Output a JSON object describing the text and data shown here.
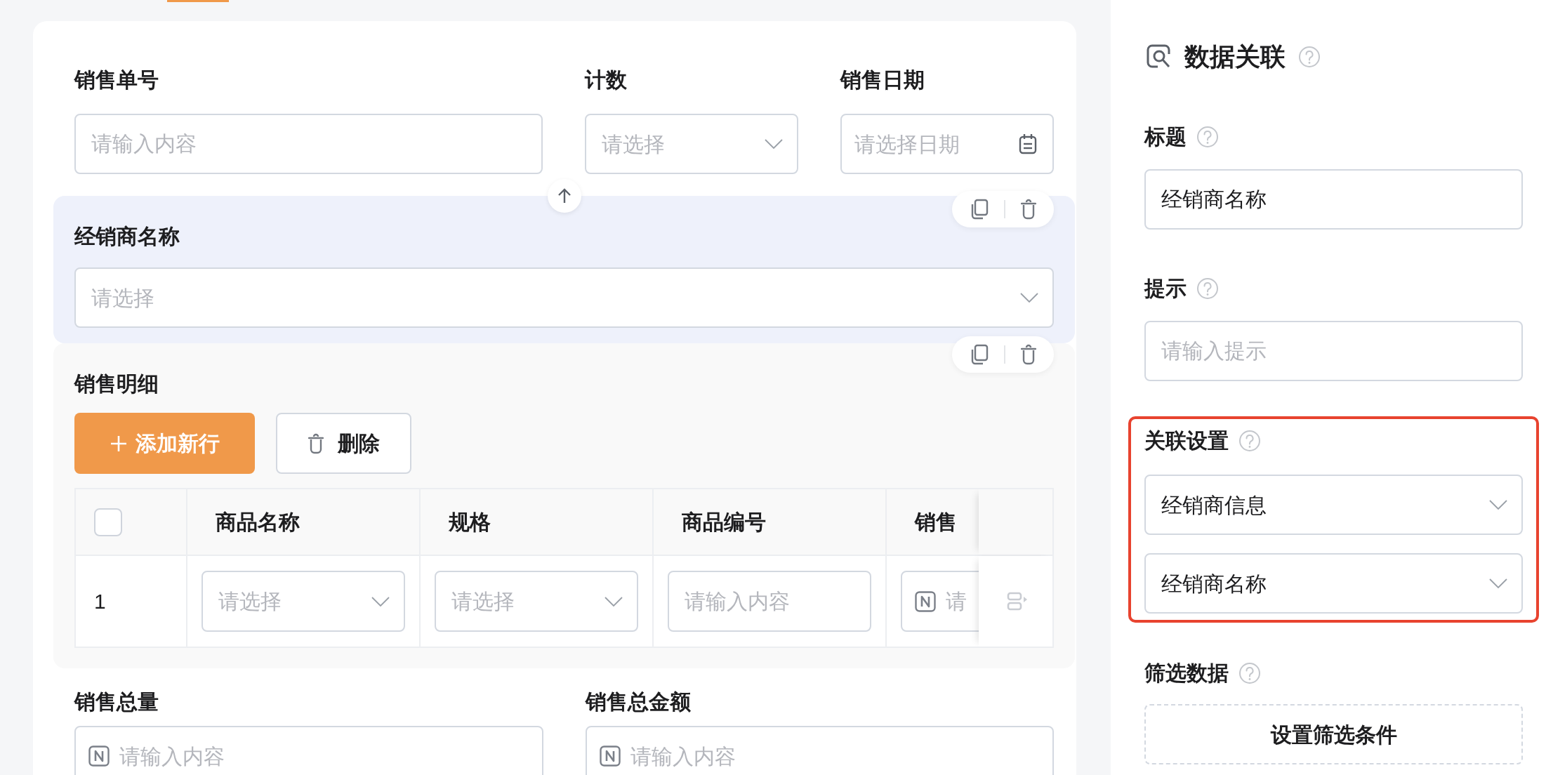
{
  "form": {
    "top_fields": [
      {
        "label": "销售单号",
        "kind": "input",
        "placeholder": "请输入内容"
      },
      {
        "label": "计数",
        "kind": "select",
        "placeholder": "请选择"
      },
      {
        "label": "销售日期",
        "kind": "date",
        "placeholder": "请选择日期"
      }
    ],
    "blocks": [
      {
        "kind": "field",
        "selected": true,
        "label": "经销商名称",
        "placeholder": "请选择"
      },
      {
        "kind": "subtable",
        "selected": false,
        "title": "销售明细",
        "buttons": [
          {
            "kind": "primary",
            "label": "添加新行"
          },
          {
            "kind": "delete",
            "label": "删除"
          }
        ],
        "header_checkbox": {
          "checked": false
        },
        "columns": [
          "商品名称",
          "规格",
          "商品编号",
          "销售"
        ],
        "rows": [
          {
            "index": "1",
            "cells": [
              {
                "kind": "select",
                "placeholder": "请选择"
              },
              {
                "kind": "select",
                "placeholder": "请选择"
              },
              {
                "kind": "input",
                "placeholder": "请输入内容"
              },
              {
                "kind": "number",
                "placeholder": "请"
              }
            ]
          }
        ]
      }
    ],
    "bottom_fields": [
      {
        "label": "销售总量",
        "kind": "number",
        "placeholder": "请输入内容"
      },
      {
        "label": "销售总金额",
        "kind": "number",
        "placeholder": "请输入内容"
      }
    ]
  },
  "properties": {
    "title": "数据关联",
    "fields": [
      {
        "label": "标题",
        "value": "经销商名称"
      },
      {
        "label": "提示",
        "placeholder": "请输入提示"
      }
    ],
    "association": {
      "label": "关联设置",
      "highlighted": true,
      "selects": [
        {
          "value": "经销商信息"
        },
        {
          "value": "经销商名称"
        }
      ]
    },
    "filter": {
      "label": "筛选数据",
      "button": "设置筛选条件"
    }
  }
}
